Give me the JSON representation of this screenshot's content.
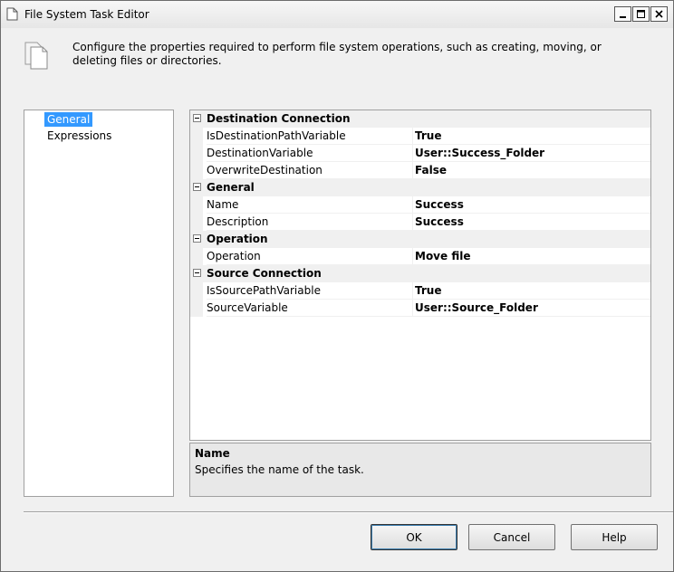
{
  "window": {
    "title": "File System Task Editor"
  },
  "header": {
    "text": "Configure the properties required to perform file system operations, such as creating, moving, or deleting files or directories."
  },
  "nav": {
    "items": [
      {
        "label": "General",
        "selected": true
      },
      {
        "label": "Expressions",
        "selected": false
      }
    ]
  },
  "grid": {
    "categories": [
      {
        "label": "Destination Connection",
        "rows": [
          {
            "name": "IsDestinationPathVariable",
            "value": "True"
          },
          {
            "name": "DestinationVariable",
            "value": "User::Success_Folder"
          },
          {
            "name": "OverwriteDestination",
            "value": "False"
          }
        ]
      },
      {
        "label": "General",
        "rows": [
          {
            "name": "Name",
            "value": "Success"
          },
          {
            "name": "Description",
            "value": "Success"
          }
        ]
      },
      {
        "label": "Operation",
        "rows": [
          {
            "name": "Operation",
            "value": "Move file"
          }
        ]
      },
      {
        "label": "Source Connection",
        "rows": [
          {
            "name": "IsSourcePathVariable",
            "value": "True"
          },
          {
            "name": "SourceVariable",
            "value": "User::Source_Folder"
          }
        ]
      }
    ]
  },
  "description": {
    "title": "Name",
    "text": "Specifies the name of the task."
  },
  "buttons": {
    "ok": "OK",
    "cancel": "Cancel",
    "help": "Help"
  }
}
